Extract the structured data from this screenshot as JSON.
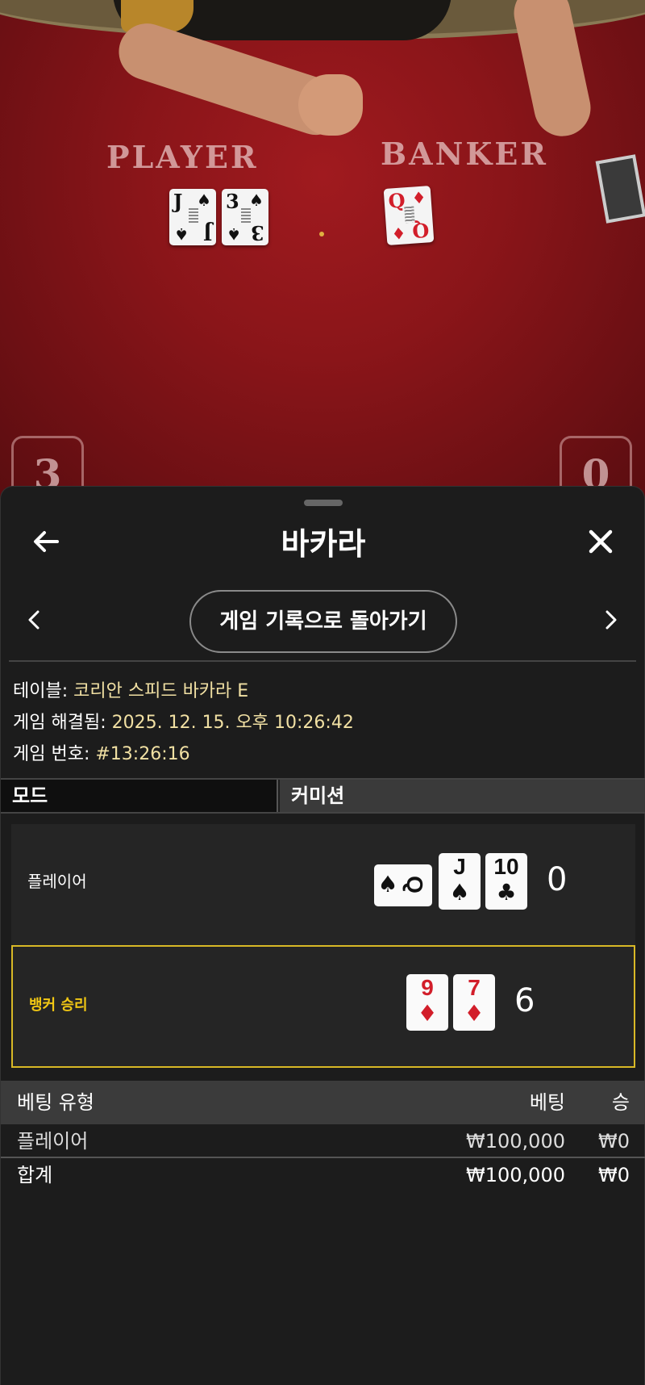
{
  "video": {
    "player_label": "PLAYER",
    "banker_label": "BANKER",
    "player_cards": [
      {
        "rank": "J",
        "suit": "♠"
      },
      {
        "rank": "3",
        "suit": "♠"
      }
    ],
    "banker_cards": [
      {
        "rank": "Q",
        "suit": "♦"
      }
    ],
    "player_score": "3",
    "banker_score": "0"
  },
  "header": {
    "title": "바카라"
  },
  "history_button": "게임 기록으로 돌아가기",
  "info": {
    "table_label": "테이블: ",
    "table_value": "코리안 스피드 바카라 E",
    "resolved_label": "게임 해결됨: ",
    "resolved_value": "2025. 12. 15. 오후 10:26:42",
    "number_label": "게임 번호: ",
    "number_value": "#13:26:16"
  },
  "tabs": {
    "mode": "모드",
    "commission": "커미션"
  },
  "result": {
    "player": {
      "label": "플레이어",
      "cards": [
        {
          "rank": "Q",
          "suit": "♠",
          "sideways": true
        },
        {
          "rank": "J",
          "suit": "♠"
        },
        {
          "rank": "10",
          "suit": "♣"
        }
      ],
      "score": "0"
    },
    "banker": {
      "label": "뱅커 승리",
      "cards": [
        {
          "rank": "9",
          "suit": "♦"
        },
        {
          "rank": "7",
          "suit": "♦"
        }
      ],
      "score": "6"
    }
  },
  "bets": {
    "headers": {
      "type": "베팅 유형",
      "bet": "베팅",
      "win": "승"
    },
    "rows": [
      {
        "type": "플레이어",
        "bet": "₩100,000",
        "win": "₩0"
      }
    ],
    "total": {
      "type": "합계",
      "bet": "₩100,000",
      "win": "₩0"
    }
  },
  "colors": {
    "winner_highlight": "#d8b826",
    "info_value": "#f1e0a3",
    "red_suit": "#d21e2a"
  }
}
